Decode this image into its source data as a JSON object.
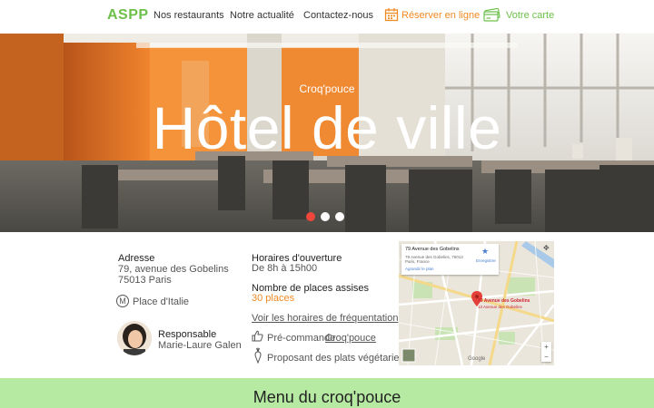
{
  "nav": {
    "logo": "ASPP",
    "links": [
      "Nos restaurants",
      "Notre actualité",
      "Contactez-nous"
    ],
    "reserve_label": "Réserver en ligne",
    "card_label": "Votre carte",
    "icons": [
      "calendar-icon",
      "card-icon"
    ]
  },
  "hero": {
    "subtitle": "Croq'pouce",
    "title": "Hôtel de ville",
    "slides": 3,
    "active_slide": 0
  },
  "info": {
    "address_label": "Adresse",
    "address_line1": "79, avenue des Gobelins",
    "address_line2": "75013 Paris",
    "metro": "Place d'Italie",
    "manager_label": "Responsable",
    "manager_name": "Marie-Laure Galen",
    "hours_label": "Horaires d'ouverture",
    "hours_value": "De 8h à 15h00",
    "seats_label": "Nombre de places assises",
    "seats_value": "30 places",
    "attendance_link": "Voir les horaires de fréquentation",
    "preorder_text": "Pré-commande ",
    "preorder_link": "Croq'pouce",
    "vegetarian": "Proposant des plats végétariens"
  },
  "map": {
    "card_title": "79 Avenue des Gobelins",
    "card_address": "79 Avenue des Gobelins, 75013 Paris, France",
    "enlarge": "Agrandir le plan",
    "save": "Enregistrer",
    "pin_label": "79 Avenue des Gobelins",
    "pin_sub": "13 Avenue des Gobelins",
    "brand": "Google"
  },
  "menu": {
    "title": "Menu du croq'pouce"
  },
  "colors": {
    "green": "#6cc04a",
    "orange": "#f08a24",
    "menu_bar": "#b6eaa2",
    "dot_active": "#f0473a"
  }
}
